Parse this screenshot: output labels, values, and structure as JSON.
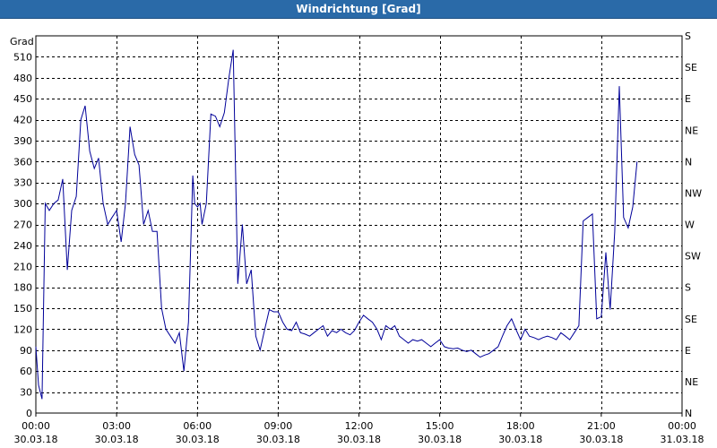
{
  "window": {
    "title": "Windrichtung [Grad]"
  },
  "chart_data": {
    "type": "line",
    "title": "Windrichtung [Grad]",
    "ylabel": "Grad",
    "ylim": [
      0,
      540
    ],
    "yticks": [
      0,
      30,
      60,
      90,
      120,
      150,
      180,
      210,
      240,
      270,
      300,
      330,
      360,
      390,
      420,
      450,
      480,
      510
    ],
    "right_labels": [
      "N",
      "NE",
      "E",
      "SE",
      "S",
      "SW",
      "W",
      "NW",
      "N",
      "NE",
      "E",
      "SE",
      "S"
    ],
    "x_ticks": [
      {
        "time": "00:00",
        "date": "30.03.18"
      },
      {
        "time": "03:00",
        "date": "30.03.18"
      },
      {
        "time": "06:00",
        "date": "30.03.18"
      },
      {
        "time": "09:00",
        "date": "30.03.18"
      },
      {
        "time": "12:00",
        "date": "30.03.18"
      },
      {
        "time": "15:00",
        "date": "30.03.18"
      },
      {
        "time": "18:00",
        "date": "30.03.18"
      },
      {
        "time": "21:00",
        "date": "30.03.18"
      },
      {
        "time": "00:00",
        "date": "31.03.18"
      }
    ],
    "grid": true,
    "line_color": "#000099",
    "series": [
      {
        "x_hours": [
          0,
          0.1,
          0.23,
          0.35,
          0.5,
          0.67,
          0.83,
          1.0,
          1.17,
          1.33,
          1.5,
          1.67,
          1.83,
          2.0,
          2.17,
          2.33,
          2.5,
          2.67,
          2.83,
          3.0,
          3.17,
          3.33,
          3.5,
          3.67,
          3.83,
          4.0,
          4.17,
          4.33,
          4.5,
          4.67,
          4.83,
          5.0,
          5.17,
          5.33,
          5.5,
          5.67,
          5.83,
          5.9,
          6.0,
          6.1,
          6.17,
          6.33,
          6.5,
          6.67,
          6.83,
          7.0,
          7.17,
          7.33,
          7.5,
          7.67,
          7.83,
          8.0,
          8.17,
          8.33,
          8.5,
          8.67,
          8.83,
          9.0,
          9.17,
          9.33,
          9.5,
          9.67,
          9.83,
          10.0,
          10.17,
          10.33,
          10.5,
          10.67,
          10.83,
          11.0,
          11.17,
          11.33,
          11.5,
          11.67,
          11.83,
          12.0,
          12.17,
          12.33,
          12.5,
          12.67,
          12.83,
          13.0,
          13.17,
          13.33,
          13.5,
          13.67,
          13.83,
          14.0,
          14.17,
          14.33,
          14.5,
          14.67,
          14.83,
          15.0,
          15.17,
          15.33,
          15.5,
          15.67,
          15.83,
          16.0,
          16.17,
          16.33,
          16.5,
          16.67,
          16.83,
          17.0,
          17.17,
          17.33,
          17.5,
          17.67,
          17.83,
          18.0,
          18.17,
          18.33,
          18.5,
          18.67,
          18.83,
          19.0,
          19.17,
          19.33,
          19.5,
          19.67,
          19.83,
          20.0,
          20.17,
          20.33,
          20.5,
          20.67,
          20.83,
          21.0,
          21.17,
          21.33,
          21.5,
          21.67,
          21.83,
          22.0,
          22.17,
          22.33,
          22.5,
          22.67,
          22.83,
          23.0,
          23.17,
          23.33,
          23.5,
          23.67,
          23.83,
          24.0
        ],
        "y": [
          95,
          40,
          20,
          300,
          290,
          300,
          305,
          335,
          205,
          290,
          310,
          420,
          440,
          375,
          350,
          365,
          300,
          270,
          280,
          290,
          245,
          300,
          410,
          370,
          355,
          270,
          290,
          260,
          260,
          150,
          120,
          110,
          100,
          115,
          60,
          130,
          340,
          300,
          295,
          300,
          270,
          300,
          428,
          425,
          410,
          430,
          480,
          520,
          185,
          270,
          185,
          205,
          110,
          90,
          120,
          148,
          145,
          145,
          130,
          120,
          118,
          130,
          115,
          113,
          110,
          115,
          120,
          125,
          110,
          118,
          115,
          120,
          115,
          112,
          118,
          130,
          140,
          135,
          130,
          120,
          105,
          125,
          120,
          125,
          110,
          105,
          100,
          105,
          103,
          105,
          100,
          95,
          100,
          105,
          95,
          93,
          92,
          93,
          90,
          88,
          90,
          85,
          80,
          83,
          85,
          90,
          95,
          110,
          125,
          135,
          120,
          105,
          120,
          110,
          108,
          105,
          108,
          110,
          108,
          105,
          115,
          110,
          105,
          115,
          125,
          275,
          280,
          285,
          135,
          138,
          230,
          148,
          260,
          468,
          280,
          265,
          295,
          360
        ]
      }
    ]
  }
}
